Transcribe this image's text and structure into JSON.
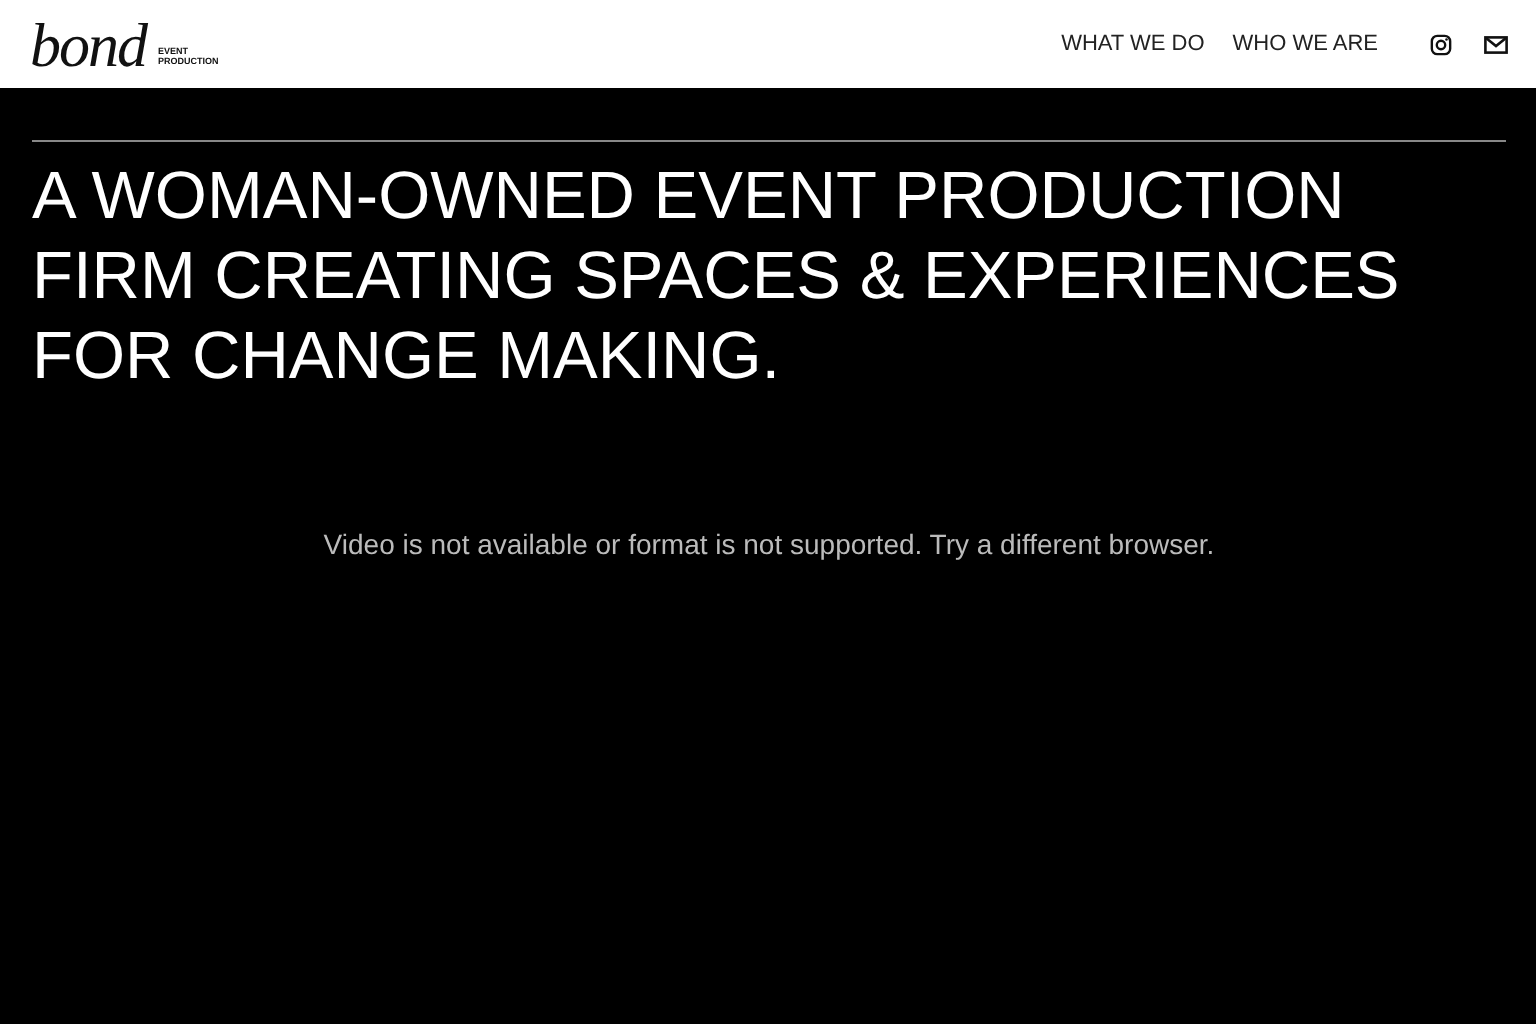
{
  "header": {
    "logo": {
      "word": "bond",
      "tagline": [
        "EVENT",
        "PRODUCTION"
      ]
    },
    "nav": [
      "WHAT WE DO",
      "WHO WE ARE"
    ]
  },
  "hero": {
    "headline": [
      "A WOMAN-OWNED EVENT PRODUCTION",
      "FIRM CREATING SPACES & EXPERIENCES",
      "FOR CHANGE MAKING."
    ],
    "video_message": "Video is not available or format is not supported. Try a different browser."
  }
}
